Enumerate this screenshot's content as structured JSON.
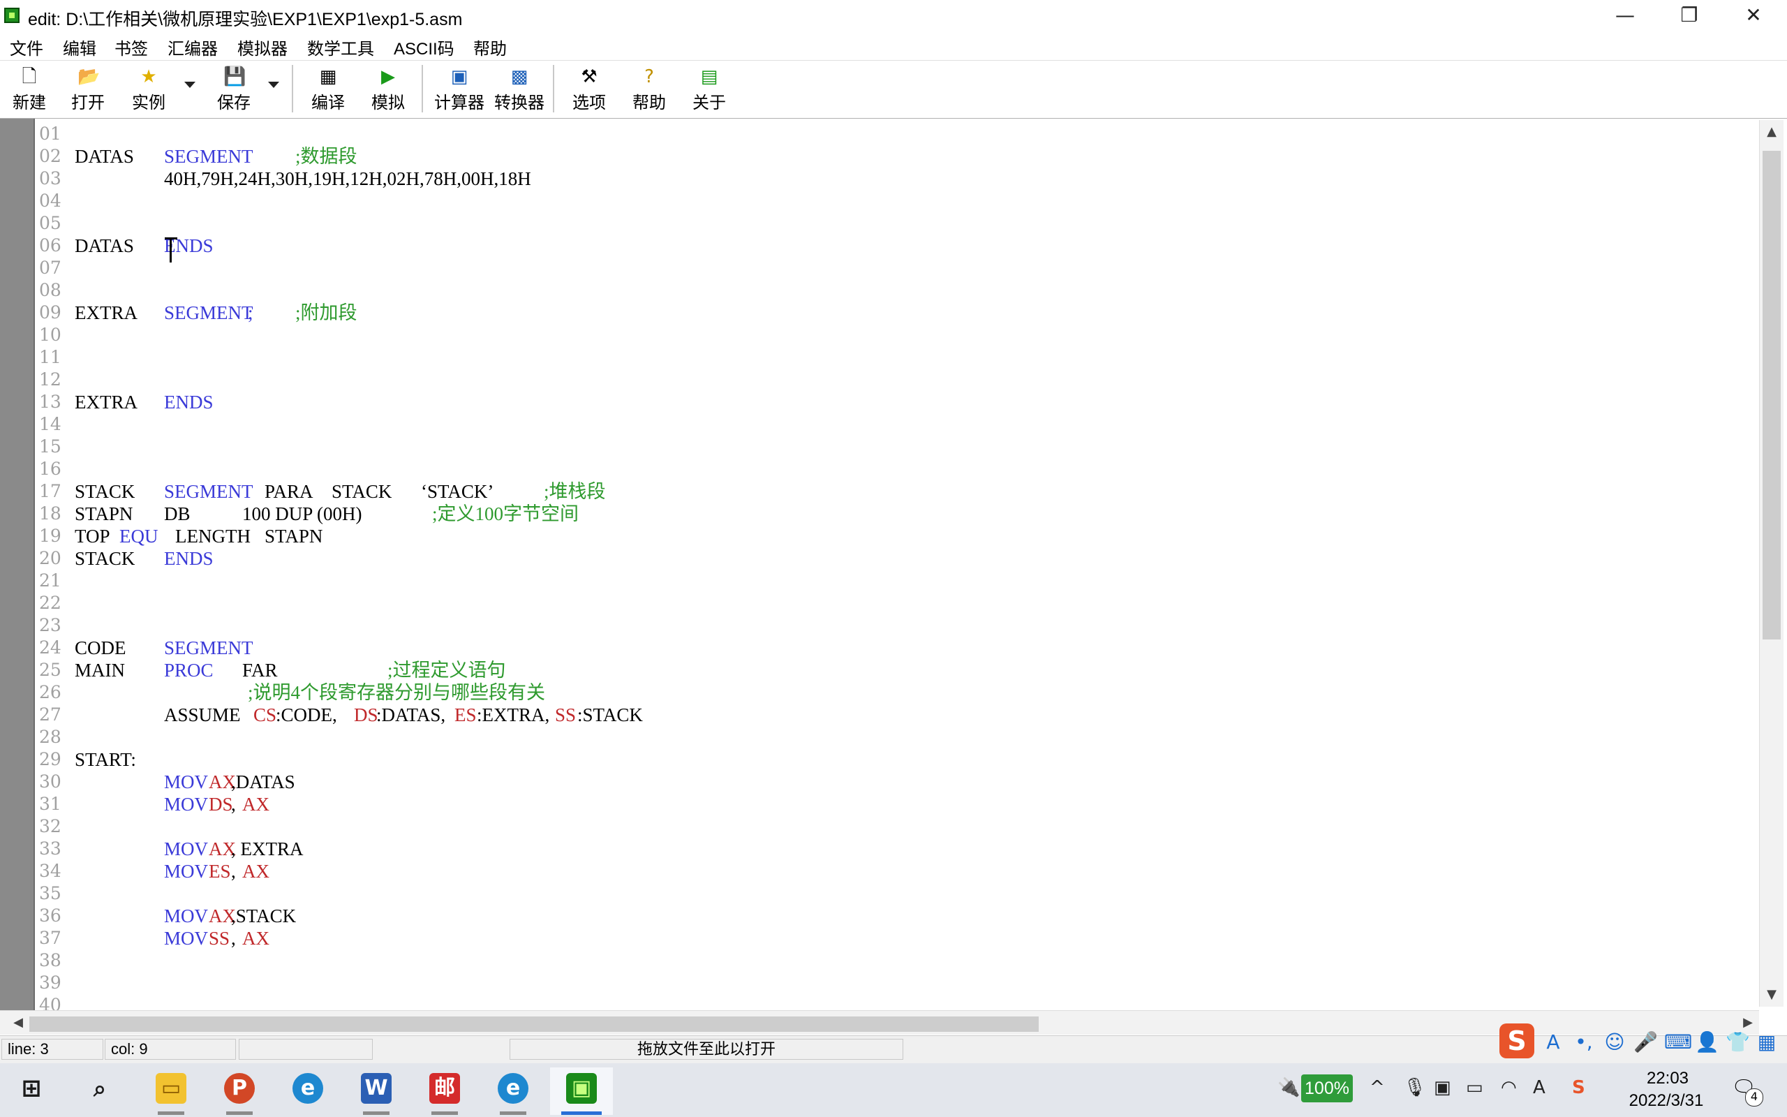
{
  "window": {
    "title": "edit: D:\\工作相关\\微机原理实验\\EXP1\\EXP1\\exp1-5.asm",
    "minimize": "—",
    "maximize": "❐",
    "close": "✕"
  },
  "menu": [
    "文件",
    "编辑",
    "书签",
    "汇编器",
    "模拟器",
    "数学工具",
    "ASCII码",
    "帮助"
  ],
  "toolbar": {
    "new": "新建",
    "open": "打开",
    "examples": "实例",
    "save": "保存",
    "compile": "编译",
    "emulate": "模拟",
    "calculator": "计算器",
    "converter": "转换器",
    "options": "选项",
    "help": "帮助",
    "about": "关于"
  },
  "line_numbers": [
    "01",
    "02",
    "03",
    "04",
    "05",
    "06",
    "07",
    "08",
    "09",
    "10",
    "11",
    "12",
    "13",
    "14",
    "15",
    "16",
    "17",
    "18",
    "19",
    "20",
    "21",
    "22",
    "23",
    "24",
    "25",
    "26",
    "27",
    "28",
    "29",
    "30",
    "31",
    "32",
    "33",
    "34",
    "35",
    "36",
    "37",
    "38",
    "39",
    "40"
  ],
  "code": {
    "l02": {
      "a": "DATAS",
      "b": "SEGMENT",
      "c": ";数据段"
    },
    "l03": {
      "b": "40H,79H,24H,30H,19H,12H,02H,78H,00H,18H"
    },
    "l06": {
      "a": "DATAS",
      "b": "ENDS"
    },
    "l09": {
      "a": "EXTRA",
      "b": "SEGMENT",
      "c": ";",
      "d": ";附加段"
    },
    "l13": {
      "a": "EXTRA",
      "b": "ENDS"
    },
    "l17": {
      "a": "STACK",
      "b": "SEGMENT",
      "c": "PARA",
      "d": "STACK",
      "e": "‘STACK’",
      "f": ";堆栈段"
    },
    "l18": {
      "a": "STAPN",
      "b": "DB",
      "c": "100 DUP (00H)",
      "d": ";定义100字节空间"
    },
    "l19": {
      "a": "TOP",
      "b": "EQU",
      "c": "LENGTH",
      "d": "STAPN"
    },
    "l20": {
      "a": "STACK",
      "b": "ENDS"
    },
    "l24": {
      "a": "CODE",
      "b": "SEGMENT"
    },
    "l25": {
      "a": "MAIN",
      "b": "PROC",
      "c": "FAR",
      "d": ";过程定义语句"
    },
    "l26": {
      "d": ";说明4个段寄存器分别与哪些段有关"
    },
    "l27": {
      "b": "ASSUME",
      "c1": "CS",
      "c2": ":CODE,",
      "c3": "DS",
      "c4": ":DATAS,",
      "c5": "ES",
      "c6": ":EXTRA,",
      "c7": "SS",
      "c8": ":STACK"
    },
    "l29": {
      "a": "START:"
    },
    "l30": {
      "m": "MOV",
      "r": "AX",
      "t": ",DATAS"
    },
    "l31": {
      "m": "MOV",
      "r": "DS",
      "t": ",",
      "r2": "AX"
    },
    "l33": {
      "m": "MOV",
      "r": "AX",
      "t": ", EXTRA"
    },
    "l34": {
      "m": "MOV",
      "r": "ES",
      "t": ",",
      "r2": "AX"
    },
    "l36": {
      "m": "MOV",
      "r": "AX",
      "t": ",STACK"
    },
    "l37": {
      "m": "MOV",
      "r": "SS",
      "t": ",",
      "r2": "AX"
    }
  },
  "status": {
    "line": "line: 3",
    "col": "col: 9",
    "drop_hint": "拖放文件至此以打开"
  },
  "tray": {
    "battery": "100%",
    "time": "22:03",
    "date": "2022/3/31",
    "notifications": "4"
  },
  "colors": {
    "keyword": "#3a3ad8",
    "register": "#c0282a",
    "comment": "#2e9a2e",
    "line_number": "#a0a0a0"
  }
}
